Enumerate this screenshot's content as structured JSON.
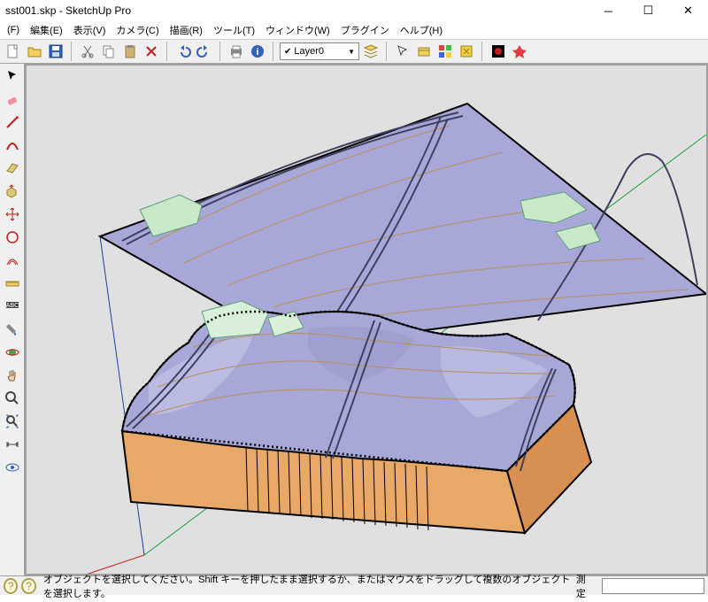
{
  "window": {
    "title": "sst001.skp - SketchUp Pro"
  },
  "menu": {
    "file": "(F)",
    "edit": "編集(E)",
    "view": "表示(V)",
    "camera": "カメラ(C)",
    "draw": "描画(R)",
    "tool": "ツール(T)",
    "window": "ウィンドウ(W)",
    "plugin": "プラグイン",
    "help": "ヘルプ(H)"
  },
  "toolbar": {
    "layer_current": "Layer0"
  },
  "status": {
    "hint1": "オブジェクトを選択してください。Shift キーを押したまま選択するか、またはマウスをドラッグして複数のオブジェクトを選択します。",
    "measure_label": "測定"
  },
  "colors": {
    "terrain_top": "#a8a8d8",
    "terrain_side": "#e8a868",
    "bldg": "#c8e8c8",
    "road": "#404060",
    "contour": "#b89058",
    "axis_b": "#2040a0",
    "axis_r": "#c02020",
    "axis_g": "#20a040"
  }
}
